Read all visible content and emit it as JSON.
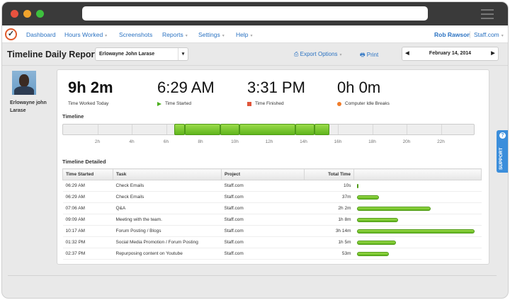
{
  "window": {
    "traffic_lights": [
      "#e8523f",
      "#f0a32c",
      "#3ec03e"
    ]
  },
  "nav": {
    "items": [
      {
        "label": "Dashboard",
        "dropdown": false
      },
      {
        "label": "Hours Worked",
        "dropdown": true
      },
      {
        "label": "Screenshots",
        "dropdown": false
      },
      {
        "label": "Reports",
        "dropdown": true
      },
      {
        "label": "Settings",
        "dropdown": true
      },
      {
        "label": "Help",
        "dropdown": true
      }
    ],
    "user": "Rob Rawson",
    "company": "Staff.com",
    "caret": "▾"
  },
  "toolbar": {
    "title": "Timeline Daily Report",
    "employee": "Erlowayne John Larase",
    "export": "Export Options",
    "print": "Print",
    "date": "February 14, 2014",
    "prev": "◀",
    "next": "▶"
  },
  "profile": {
    "name": "Erlowayne john Larase"
  },
  "stats": [
    {
      "value": "9h 2m",
      "label": "Time Worked Today"
    },
    {
      "value": "6:29 AM",
      "label": "Time Started",
      "icon": "play-icon",
      "color": "#4caf1f"
    },
    {
      "value": "3:31 PM",
      "label": "Time Finished",
      "icon": "stop-icon",
      "color": "#e0553a"
    },
    {
      "value": "0h 0m",
      "label": "Computer Idle Breaks",
      "icon": "idle-icon",
      "color": "#f07c2a"
    }
  ],
  "timeline": {
    "title": "Timeline",
    "ticks": [
      "2h",
      "4h",
      "6h",
      "8h",
      "10h",
      "12h",
      "14h",
      "16h",
      "18h",
      "20h",
      "22h"
    ],
    "segments": [
      [
        6.48,
        7.1
      ],
      [
        7.1,
        9.15
      ],
      [
        9.15,
        10.28
      ],
      [
        10.28,
        13.53
      ],
      [
        13.53,
        14.62
      ],
      [
        14.62,
        15.52
      ]
    ]
  },
  "detailed": {
    "title": "Timeline Detailed",
    "headers": [
      "Time Started",
      "Task",
      "Project",
      "Total Time"
    ],
    "rows": [
      {
        "start": "06:29 AM",
        "task": "Check Emails",
        "project": "Staff.com",
        "total": "10s",
        "minutes": 0.17
      },
      {
        "start": "06:29 AM",
        "task": "Check Emails",
        "project": "Staff.com",
        "total": "37m",
        "minutes": 37
      },
      {
        "start": "07:06 AM",
        "task": "Q&A",
        "project": "Staff.com",
        "total": "2h 2m",
        "minutes": 122
      },
      {
        "start": "09:09 AM",
        "task": "Meeting with the team.",
        "project": "Staff.com",
        "total": "1h 8m",
        "minutes": 68
      },
      {
        "start": "10:17 AM",
        "task": "Forum Posting / Blogs",
        "project": "Staff.com",
        "total": "3h 14m",
        "minutes": 194
      },
      {
        "start": "01:32 PM",
        "task": "Social Media Promotion / Forum Posting",
        "project": "Staff.com",
        "total": "1h 5m",
        "minutes": 65
      },
      {
        "start": "02:37 PM",
        "task": "Repurposing content on Youtube",
        "project": "Staff.com",
        "total": "53m",
        "minutes": 53
      }
    ]
  },
  "support": {
    "label": "SUPPORT",
    "icon": "?"
  }
}
